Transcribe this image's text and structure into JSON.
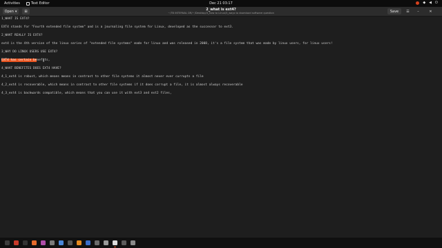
{
  "topbar": {
    "activities": "Activities",
    "app_name": "Text Editor",
    "clock": "Dec 21  03:17",
    "tray": [
      "⏻"
    ]
  },
  "header": {
    "open_label": "Open",
    "open_icon": "chevron-down-icon",
    "new_doc_icon": "new-document-icon",
    "title": "2_what is ext4?",
    "path": "~/TB INTERNAL DR/~/Desktop/3_how to Linux/3_ways to download software question",
    "save_label": "Save",
    "menu_icon": "hamburger-menu-icon",
    "minimize_icon": "minimize-icon",
    "close_icon": "close-icon"
  },
  "document": {
    "lines": [
      "1_WHAT IS EXT4?",
      "",
      "EXT4 stands for \"Fourth extended file system\" and is a journaling file system for Linux, developed as the successor to ext3.",
      "",
      "2_WHAT REALLY IS EXT4?",
      "",
      "ext4 is the 4th version of the linux series of \"extended file systems\" made for linux and was released in 2008, it's a file system that was made by linux users, for linux users!",
      "",
      "3_WHY DO LINUX USERS USE EXT4?",
      "",
      "",
      "",
      "4_WHAT BENEFITES DOES EXT4 HAVE?",
      "",
      "4_1_ext4 is robust, which means means in contrast to other file systems it almost never ever currupts a file",
      "",
      "4_2_ext4 is recoverable, which means in contrast to other file systems if it does corrupt a file, it is almost always recoverable",
      "",
      "4_3_ext4 is backwards compatible, which means that you can use it with ext3 and ext2 files,"
    ],
    "selected_line": {
      "selected": "EXT4 has certain be",
      "rest": "nefits,"
    }
  },
  "dock": {
    "items": [
      {
        "name": "files-icon",
        "color": "#3d3d3d"
      },
      {
        "name": "calendar-icon",
        "color": "#c93a2b"
      },
      {
        "name": "terminal-icon",
        "color": "#333333"
      },
      {
        "name": "browser-icon",
        "color": "#e66b2c"
      },
      {
        "name": "music-icon",
        "color": "#b04da8"
      },
      {
        "name": "settings-icon",
        "color": "#7a7a7a"
      },
      {
        "name": "chrome-icon",
        "color": "#4b87d9"
      },
      {
        "name": "store-icon",
        "color": "#555555"
      },
      {
        "name": "vlc-icon",
        "color": "#e58a1f"
      },
      {
        "name": "office-icon",
        "color": "#3a6dc9"
      },
      {
        "name": "help-icon",
        "color": "#6b6b6b"
      },
      {
        "name": "tools-icon",
        "color": "#9a9a9a"
      },
      {
        "name": "text-editor-icon",
        "color": "#dcdcdc"
      },
      {
        "name": "notes-icon",
        "color": "#5b5b5b"
      },
      {
        "name": "trash-icon",
        "color": "#8a8a8a"
      }
    ]
  }
}
